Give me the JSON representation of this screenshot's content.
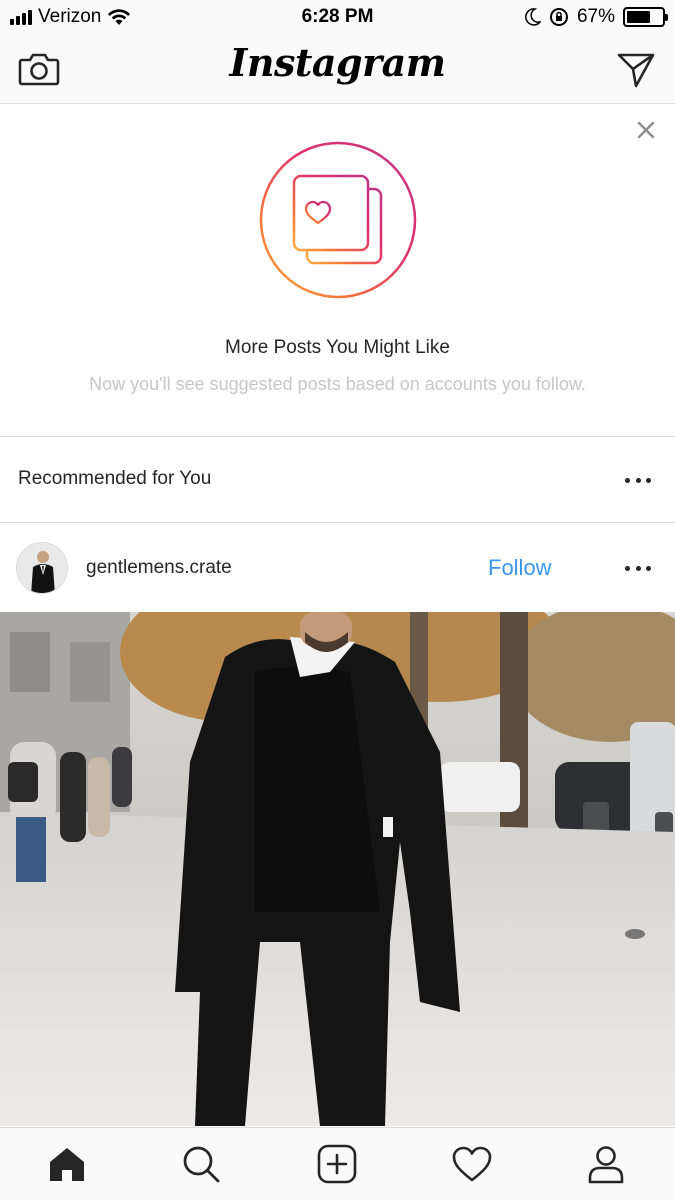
{
  "status_bar": {
    "carrier": "Verizon",
    "time": "6:28 PM",
    "battery_text": "67%",
    "battery_level": 0.67
  },
  "nav": {
    "logo": "Instagram",
    "left_icon": "camera-icon",
    "right_icon": "direct-message-icon"
  },
  "suggestion": {
    "title": "More Posts You Might Like",
    "subtitle": "Now you'll see suggested posts based on accounts you follow.",
    "icon": "liked-posts-icon",
    "ring_colors": [
      "#c13584",
      "#e1306c",
      "#f77737",
      "#fcaf45"
    ]
  },
  "recommended": {
    "title": "Recommended for You"
  },
  "post": {
    "username": "gentlemens.crate",
    "follow_label": "Follow",
    "accent": "#3897f0"
  },
  "tabs": [
    {
      "icon": "home-icon"
    },
    {
      "icon": "search-icon"
    },
    {
      "icon": "new-post-icon"
    },
    {
      "icon": "activity-heart-icon"
    },
    {
      "icon": "profile-icon"
    }
  ]
}
